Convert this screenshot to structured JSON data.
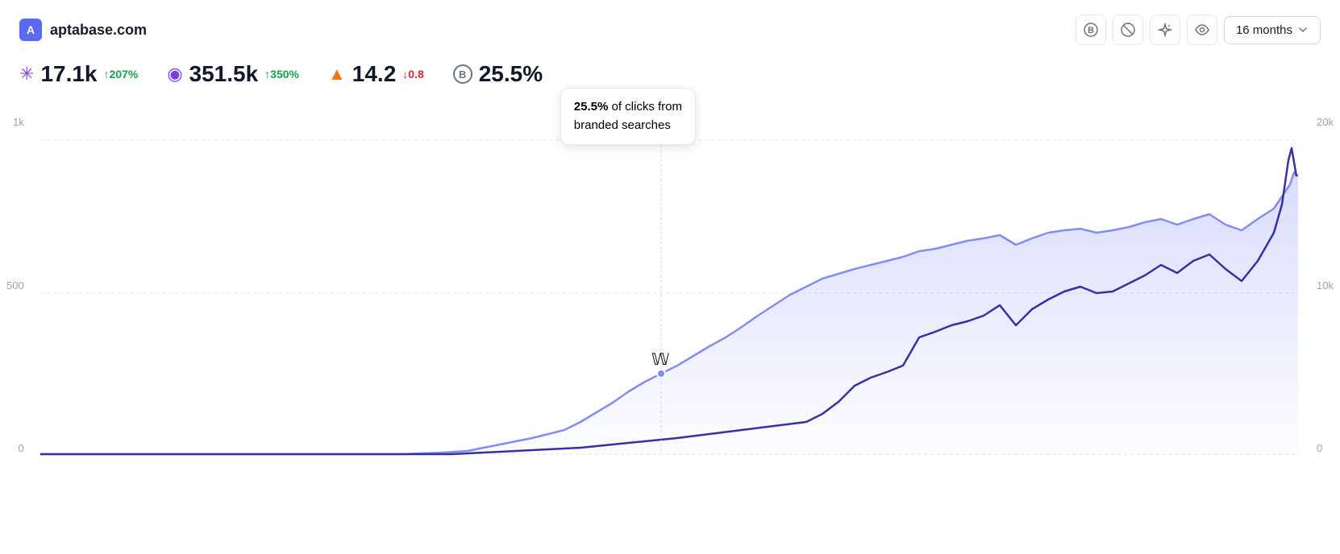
{
  "header": {
    "logo_text": "aptabase.com",
    "logo_icon": "A",
    "period_label": "16 months",
    "icons": {
      "b_icon": "Ⓑ",
      "eye_off_icon": "⊘",
      "sparkle_icon": "✳",
      "eye_icon": "◉"
    }
  },
  "metrics": [
    {
      "id": "clicks",
      "icon_type": "sparkle",
      "value": "17.1k",
      "change": "↑207%",
      "change_type": "up"
    },
    {
      "id": "impressions",
      "icon_type": "eye",
      "value": "351.5k",
      "change": "↑350%",
      "change_type": "up"
    },
    {
      "id": "position",
      "icon_type": "fire",
      "value": "14.2",
      "change": "↓0.8",
      "change_type": "down"
    },
    {
      "id": "branded",
      "icon_type": "branded",
      "value": "25.5",
      "suffix": "%",
      "change": null
    }
  ],
  "tooltip": {
    "bold_text": "25.5%",
    "description": "of clicks from\nbranded searches"
  },
  "chart": {
    "y_axis_left": [
      "1k",
      "500",
      "0"
    ],
    "y_axis_right": [
      "20k",
      "10k",
      "0"
    ],
    "colors": {
      "line1": "#6366f1",
      "line2": "#312e81",
      "fill": "rgba(99, 102, 241, 0.15)"
    }
  }
}
